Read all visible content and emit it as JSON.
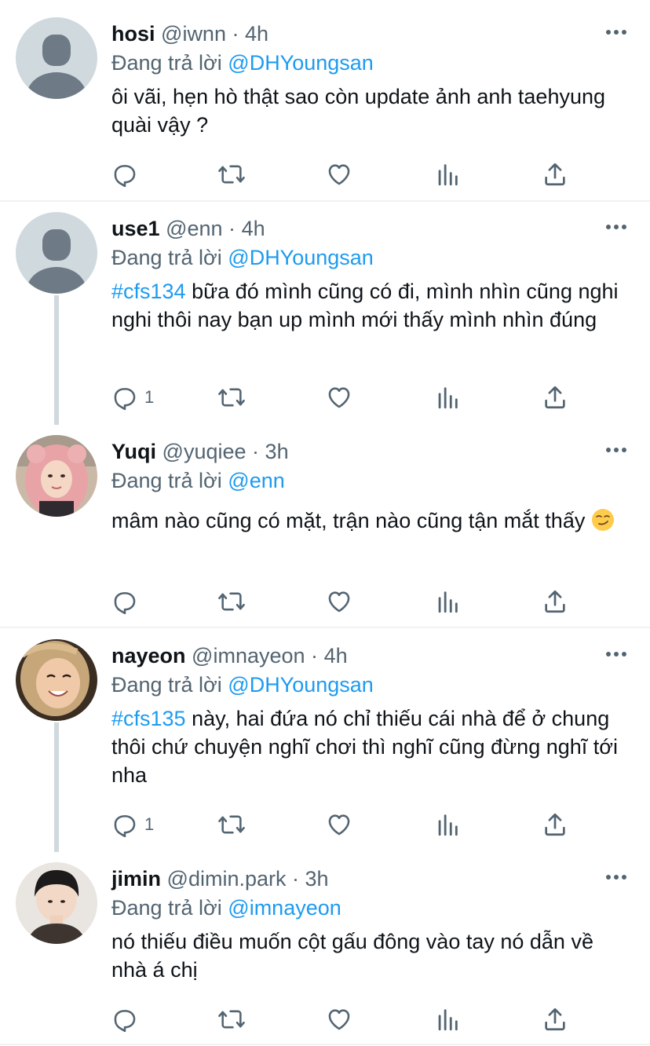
{
  "tweets": [
    {
      "name": "hosi",
      "handle": "@iwnn",
      "separator": "·",
      "time": "4h",
      "reply_prefix": "Đang trả lời",
      "reply_to": "@DHYoungsan",
      "hashtag": "",
      "text": "ôi vãi, hẹn hò thật sao còn update ảnh anh taehyung quài vậy ?",
      "reply_count": "",
      "avatar": "default-avatar"
    },
    {
      "name": "use1",
      "handle": "@enn",
      "separator": "·",
      "time": "4h",
      "reply_prefix": "Đang trả lời",
      "reply_to": "@DHYoungsan",
      "hashtag": "#cfs134",
      "text": " bữa đó mình cũng có đi, mình nhìn cũng nghi nghi thôi nay bạn up mình mới thấy mình nhìn đúng",
      "reply_count": "1",
      "avatar": "default-avatar"
    },
    {
      "name": "Yuqi",
      "handle": "@yuqiee",
      "separator": "·",
      "time": "3h",
      "reply_prefix": "Đang trả lời",
      "reply_to": "@enn",
      "hashtag": "",
      "text": "mâm nào cũng có mặt, trận nào cũng tận mắt thấy ",
      "emoji": "smirking-face",
      "reply_count": "",
      "avatar": "photo-pink-hair"
    },
    {
      "name": "nayeon",
      "handle": "@imnayeon",
      "separator": "·",
      "time": "4h",
      "reply_prefix": "Đang trả lời",
      "reply_to": "@DHYoungsan",
      "hashtag": "#cfs135",
      "text": " này, hai đứa nó chỉ thiếu cái nhà để ở chung thôi chứ chuyện nghĩ chơi thì nghĩ cũng đừng nghĩ tới nha",
      "reply_count": "1",
      "avatar": "photo-smiling-girl"
    },
    {
      "name": "jimin",
      "handle": "@dimin.park",
      "separator": "·",
      "time": "3h",
      "reply_prefix": "Đang trả lời",
      "reply_to": "@imnayeon",
      "hashtag": "",
      "text": "nó thiếu điều muốn cột gấu đông vào tay nó dẫn về nhà á chị",
      "reply_count": "",
      "avatar": "photo-dark-hair"
    }
  ],
  "icons": {
    "reply": "reply-icon",
    "retweet": "retweet-icon",
    "like": "like-icon",
    "views": "views-icon",
    "share": "share-icon",
    "more": "more-icon"
  },
  "colors": {
    "accent": "#1d9bf0",
    "secondary": "#536471",
    "primary": "#0f1419",
    "divider": "#eff3f4"
  }
}
